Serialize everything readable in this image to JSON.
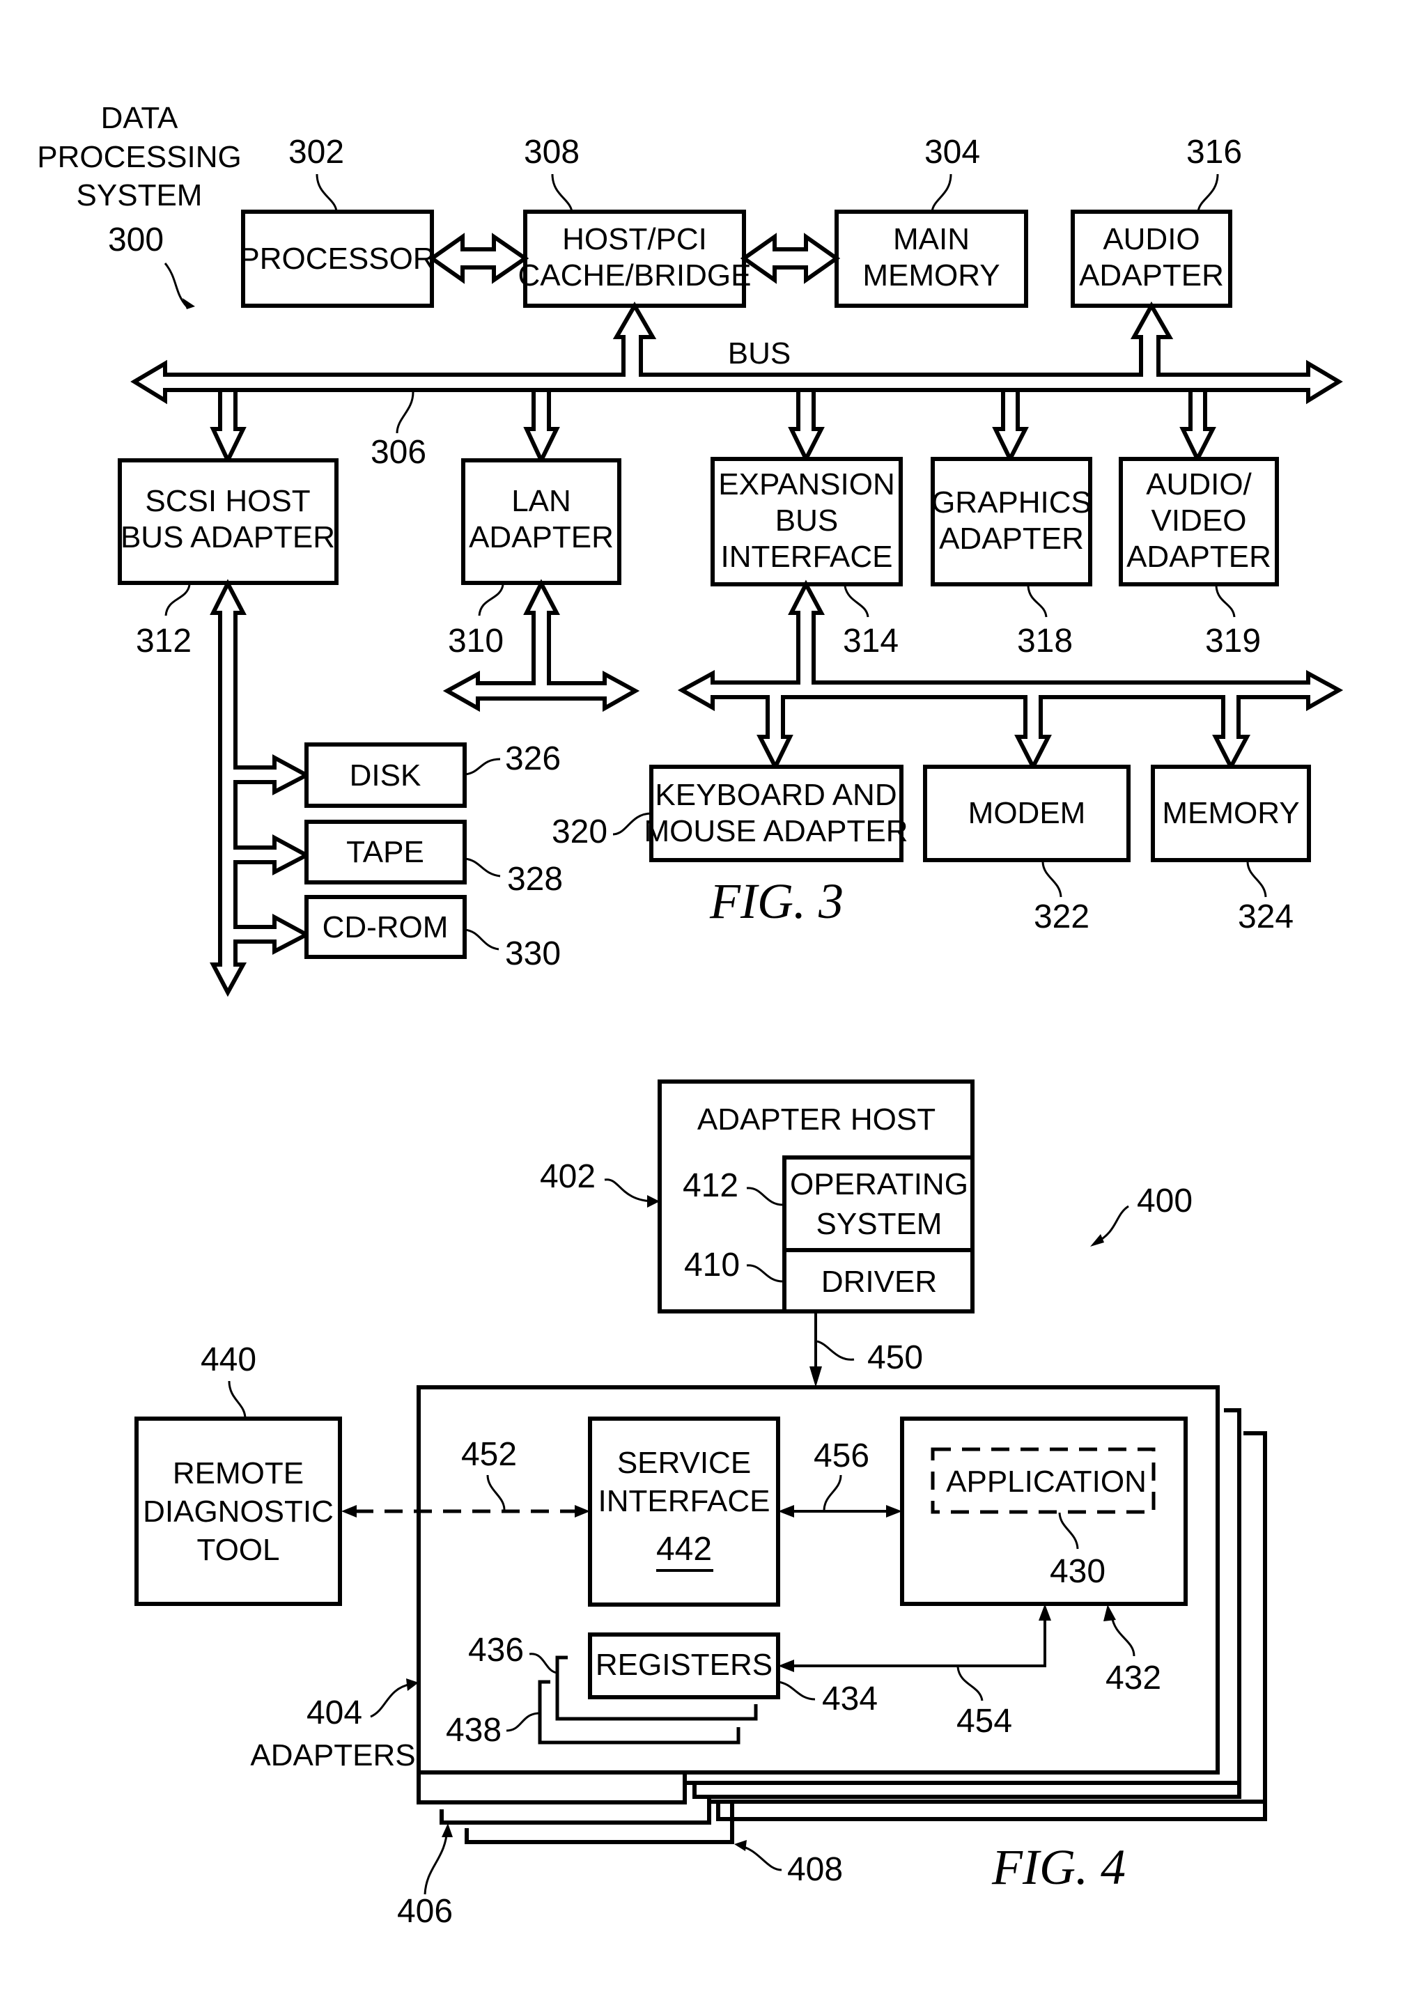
{
  "fig3": {
    "title": "FIG. 3",
    "system_label": [
      "DATA",
      "PROCESSING",
      "SYSTEM"
    ],
    "system_ref": "300",
    "bus_label": "BUS",
    "bus_ref": "306",
    "blocks": {
      "processor": {
        "lines": [
          "PROCESSOR"
        ],
        "ref": "302"
      },
      "host_bridge": {
        "lines": [
          "HOST/PCI",
          "CACHE/BRIDGE"
        ],
        "ref": "308"
      },
      "main_memory": {
        "lines": [
          "MAIN",
          "MEMORY"
        ],
        "ref": "304"
      },
      "audio_adapter": {
        "lines": [
          "AUDIO",
          "ADAPTER"
        ],
        "ref": "316"
      },
      "scsi": {
        "lines": [
          "SCSI HOST",
          "BUS ADAPTER"
        ],
        "ref": "312"
      },
      "lan": {
        "lines": [
          "LAN",
          "ADAPTER"
        ],
        "ref": "310"
      },
      "expansion": {
        "lines": [
          "EXPANSION",
          "BUS",
          "INTERFACE"
        ],
        "ref": "314"
      },
      "graphics": {
        "lines": [
          "GRAPHICS",
          "ADAPTER"
        ],
        "ref": "318"
      },
      "av_adapter": {
        "lines": [
          "AUDIO/",
          "VIDEO",
          "ADAPTER"
        ],
        "ref": "319"
      },
      "disk": {
        "lines": [
          "DISK"
        ],
        "ref": "326"
      },
      "tape": {
        "lines": [
          "TAPE"
        ],
        "ref": "328"
      },
      "cdrom": {
        "lines": [
          "CD-ROM"
        ],
        "ref": "330"
      },
      "keyboard": {
        "lines": [
          "KEYBOARD AND",
          "MOUSE ADAPTER"
        ],
        "ref": "320"
      },
      "modem": {
        "lines": [
          "MODEM"
        ],
        "ref": "322"
      },
      "memory": {
        "lines": [
          "MEMORY"
        ],
        "ref": "324"
      }
    }
  },
  "fig4": {
    "title": "FIG. 4",
    "system_ref": "400",
    "adapter_host": {
      "label": "ADAPTER HOST",
      "ref": "402"
    },
    "operating_system": {
      "lines": [
        "OPERATING",
        "SYSTEM"
      ],
      "ref": "412"
    },
    "driver": {
      "label": "DRIVER",
      "ref": "410"
    },
    "link_host_adapter_ref": "450",
    "remote_tool": {
      "lines": [
        "REMOTE",
        "DIAGNOSTIC",
        "TOOL"
      ],
      "ref": "440"
    },
    "service_interface": {
      "lines": [
        "SERVICE",
        "INTERFACE"
      ],
      "ref": "442"
    },
    "application": {
      "label": "APPLICATION",
      "ref": "430",
      "container_ref": "432"
    },
    "registers": {
      "label": "REGISTERS",
      "ref": "434",
      "stack_refs": [
        "436",
        "438"
      ]
    },
    "adapters": {
      "label": "ADAPTERS",
      "ref": "404",
      "stack_refs": [
        "406",
        "408"
      ]
    },
    "link_refs": {
      "remote_to_service": "452",
      "service_to_app": "456",
      "app_to_registers": "454"
    }
  }
}
